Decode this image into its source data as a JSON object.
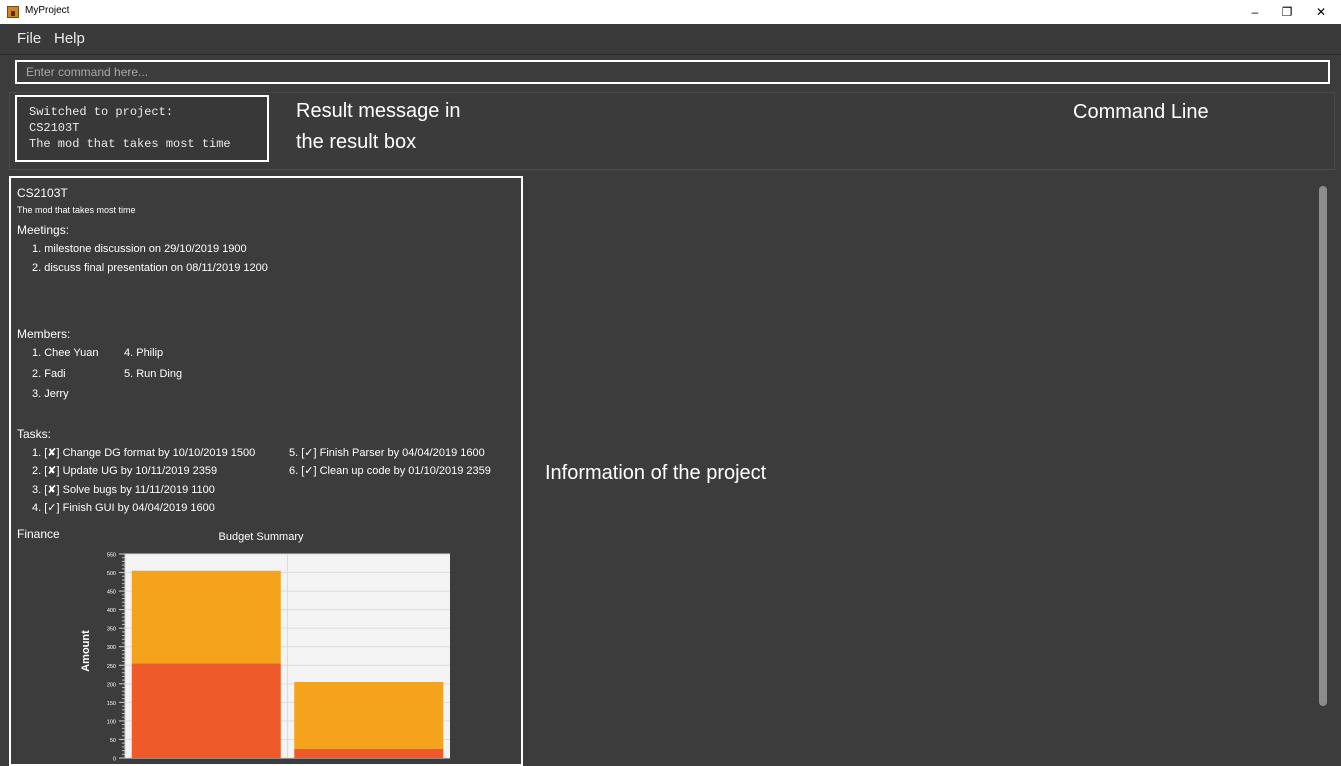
{
  "window": {
    "title": "MyProject",
    "minimize": "–",
    "restore": "❐",
    "close": "✕"
  },
  "menu": {
    "file": "File",
    "help": "Help"
  },
  "command": {
    "placeholder": "Enter command here..."
  },
  "result": {
    "lines": [
      "Switched to project:",
      "CS2103T",
      "The mod that takes most time"
    ]
  },
  "annotations": {
    "result_line1": "Result message in",
    "result_line2": "the result box",
    "command_line": "Command Line",
    "project_info": "Information of the project"
  },
  "project": {
    "name": "CS2103T",
    "description": "The mod that takes most time",
    "meetings_label": "Meetings:",
    "meetings": [
      "1. milestone discussion on 29/10/2019 1900",
      "2. discuss final presentation on 08/11/2019 1200"
    ],
    "members_label": "Members:",
    "members": [
      "1. Chee Yuan",
      "2. Fadi",
      "3. Jerry",
      "4. Philip",
      "5. Run Ding"
    ],
    "tasks_label": "Tasks:",
    "tasks": [
      "1. [✘] Change DG format by 10/10/2019 1500",
      "2. [✘] Update UG by 10/11/2019 2359",
      "3. [✘] Solve bugs by 11/11/2019 1100",
      "4. [✓] Finish GUI by 04/04/2019 1600",
      "5. [✓] Finish Parser by 04/04/2019 1600",
      "6. [✓] Clean up code by 01/10/2019 2359"
    ],
    "finance_label": "Finance"
  },
  "chart_data": {
    "type": "bar",
    "stacked": true,
    "title": "Budget Summary",
    "ylabel": "Amount",
    "ylim": [
      0,
      550
    ],
    "yticks": [
      0,
      50,
      100,
      150,
      200,
      250,
      300,
      350,
      400,
      450,
      500,
      550
    ],
    "series": [
      {
        "values": [
          255,
          25
        ],
        "color": "#ee5a2a"
      },
      {
        "values": [
          250,
          180
        ],
        "color": "#f5a31c"
      }
    ],
    "grid": true,
    "colors": {
      "plot_bg": "#f4f4f4",
      "grid": "#dcdcdc"
    }
  }
}
